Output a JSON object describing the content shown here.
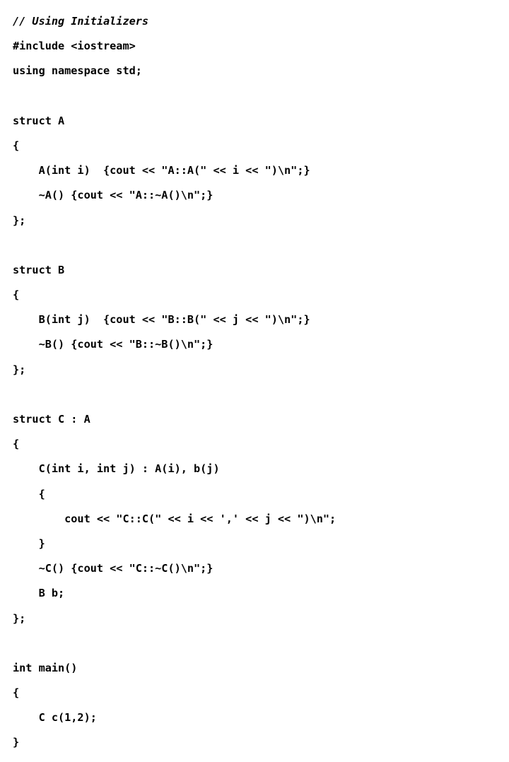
{
  "slide": {
    "title": "Using Initializers",
    "language": "cpp",
    "background_color": "#ffffff",
    "text_color": "#000000",
    "code_lines": [
      {
        "text": "// Using Initializers",
        "style": "comment"
      },
      {
        "text": "#include <iostream>",
        "style": "code"
      },
      {
        "text": "using namespace std;",
        "style": "code"
      },
      {
        "text": "",
        "style": "blank"
      },
      {
        "text": "struct A",
        "style": "code"
      },
      {
        "text": "{",
        "style": "code"
      },
      {
        "text": "    A(int i)  {cout << \"A::A(\" << i << \")\\n\";}",
        "style": "code"
      },
      {
        "text": "    ~A() {cout << \"A::~A()\\n\";}",
        "style": "code"
      },
      {
        "text": "};",
        "style": "code"
      },
      {
        "text": "",
        "style": "blank"
      },
      {
        "text": "struct B",
        "style": "code"
      },
      {
        "text": "{",
        "style": "code"
      },
      {
        "text": "    B(int j)  {cout << \"B::B(\" << j << \")\\n\";}",
        "style": "code"
      },
      {
        "text": "    ~B() {cout << \"B::~B()\\n\";}",
        "style": "code"
      },
      {
        "text": "};",
        "style": "code"
      },
      {
        "text": "",
        "style": "blank"
      },
      {
        "text": "struct C : A",
        "style": "code"
      },
      {
        "text": "{",
        "style": "code"
      },
      {
        "text": "    C(int i, int j) : A(i), b(j)",
        "style": "code"
      },
      {
        "text": "    {",
        "style": "code"
      },
      {
        "text": "        cout << \"C::C(\" << i << ',' << j << \")\\n\";",
        "style": "code"
      },
      {
        "text": "    }",
        "style": "code"
      },
      {
        "text": "    ~C() {cout << \"C::~C()\\n\";}",
        "style": "code"
      },
      {
        "text": "    B b;",
        "style": "code"
      },
      {
        "text": "};",
        "style": "code"
      },
      {
        "text": "",
        "style": "blank"
      },
      {
        "text": "int main()",
        "style": "code"
      },
      {
        "text": "{",
        "style": "code"
      },
      {
        "text": "    C c(1,2);",
        "style": "code"
      },
      {
        "text": "}",
        "style": "code"
      }
    ]
  }
}
